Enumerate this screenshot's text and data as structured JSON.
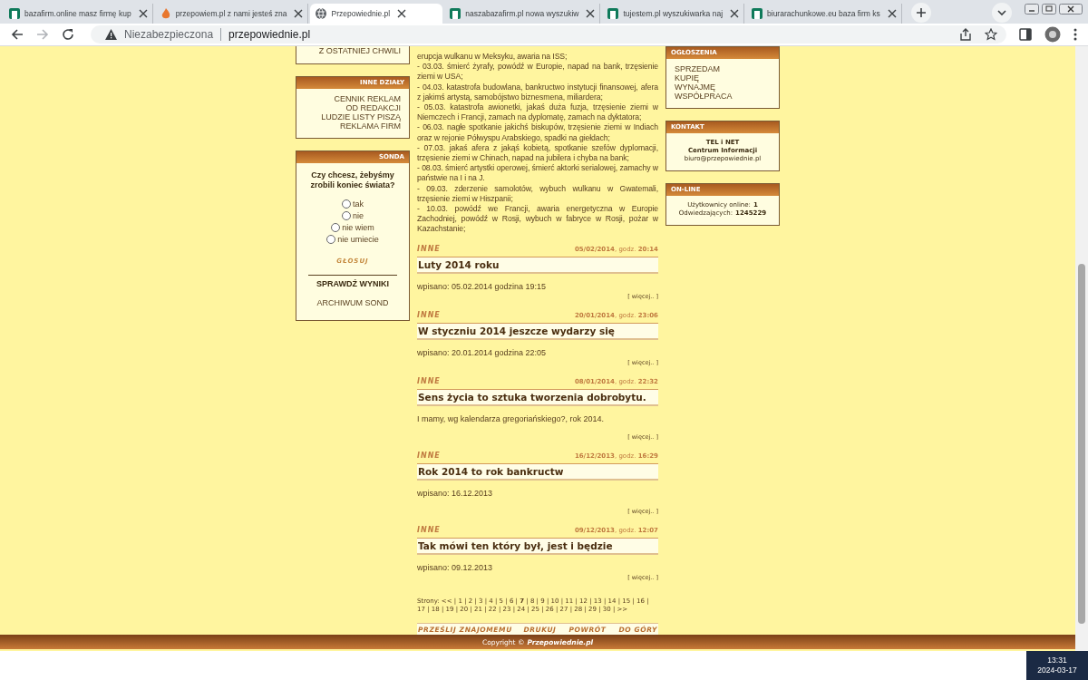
{
  "browser": {
    "tabs": [
      {
        "title": "bazafirm.online masz firmę kup",
        "kind": "sheet",
        "selected": false
      },
      {
        "title": "przepowiem.pl z nami jesteś zna",
        "kind": "flame",
        "selected": false
      },
      {
        "title": "Przepowiednie.pl",
        "kind": "globe",
        "selected": true
      },
      {
        "title": "naszabazafirm.pl nowa wyszukiw",
        "kind": "sheet",
        "selected": false
      },
      {
        "title": "tujestem.pl wyszukiwarka naj",
        "kind": "sheet",
        "selected": false
      },
      {
        "title": "biurarachunkowe.eu baza firm ks",
        "kind": "sheet",
        "selected": false
      }
    ],
    "security": "Niezabezpieczona",
    "url": "przepowiednie.pl"
  },
  "left_sidebar": {
    "cut_box": {
      "links": [
        "Z OSTATNIEJ CHWILI"
      ]
    },
    "sections": {
      "title": "INNE DZIAŁY",
      "links": [
        "CENNIK REKLAM",
        "OD REDAKCJI",
        "LUDZIE LISTY PISZĄ",
        "REKLAMA FIRM"
      ]
    },
    "poll": {
      "title": "SONDA",
      "question": "Czy chcesz, żebyśmy zrobili koniec świata?",
      "options": [
        {
          "label": "tak",
          "selected": false
        },
        {
          "label": "nie",
          "selected": false
        },
        {
          "label": "nie wiem",
          "selected": false
        },
        {
          "label": "nie umiecie",
          "selected": false
        }
      ],
      "vote": "GŁOSUJ",
      "results": "SPRAWDŹ WYNIKI",
      "archive": "ARCHIWUM SOND"
    }
  },
  "content": {
    "intro": [
      "erupcja wulkanu w Meksyku, awaria na ISS;",
      "- 03.03. śmierć żyrafy, powódź w Europie, napad na bank, trzęsienie ziemi w USA;",
      "- 04.03. katastrofa budowlana, bankructwo instytucji finansowej, afera z jakimś artystą, samobójstwo biznesmena, miliardera;",
      "- 05.03. katastrofa awionetki, jakaś duża fuzja, trzęsienie ziemi w Niemczech i Francji, zamach na dyplomatę, zamach na dyktatora;",
      "- 06.03. nagłe spotkanie jakichś biskupów, trzęsienie ziemi w Indiach oraz w rejonie Półwyspu Arabskiego, spadki na giełdach;",
      "- 07.03. jakaś afera z jakąś kobietą, spotkanie szefów dyplomacji, trzęsienie ziemi w Chinach, napad na jubilera i chyba na bank;",
      "- 08.03. śmierć artystki operowej, śmierć aktorki serialowej, zamachy w państwie na I i na J.",
      "- 09.03. zderzenie samolotów, wybuch wulkanu w Gwatemali, trzęsienie ziemi w Hiszpanii;",
      "- 10.03. powódź we Francji, awaria energetyczna w Europie Zachodniej, powódź w Rosji, wybuch w fabryce w Rosji, pożar w Kazachstanie;"
    ],
    "posts": [
      {
        "category": "INNE",
        "date": "**05/02/2014**, godz. **20:14**",
        "title": "Luty 2014 roku",
        "excerpt": "wpisano: 05.02.2014 godzina 19:15",
        "more": "[ więcej.. ]"
      },
      {
        "category": "INNE",
        "date": "**20/01/2014**, godz. **23:06**",
        "title": "W styczniu 2014 jeszcze wydarzy się",
        "excerpt": "wpisano: 20.01.2014 godzina 22:05",
        "more": "[ więcej.. ]"
      },
      {
        "category": "INNE",
        "date": "**08/01/2014**, godz. **22:32**",
        "title": "Sens życia to sztuka tworzenia dobrobytu.",
        "excerpt": "I mamy, wg kalendarza gregoriańskiego?, rok 2014.",
        "more": "[ więcej.. ]"
      },
      {
        "category": "INNE",
        "date": "**16/12/2013**, godz. **16:29**",
        "title": "Rok 2014 to rok bankructw",
        "excerpt": "wpisano: 16.12.2013",
        "more": "[ więcej.. ]"
      },
      {
        "category": "INNE",
        "date": "**09/12/2013**, godz. **12:07**",
        "title": "Tak mówi ten który był, jest i będzie",
        "excerpt": "wpisano: 09.12.2013",
        "more": "[ więcej.. ]"
      }
    ],
    "pagination": {
      "label": "Strony:",
      "prev": "<<",
      "next": ">>",
      "separator": "|",
      "pages": [
        {
          "label": "1",
          "selected": false
        },
        {
          "label": "2",
          "selected": false
        },
        {
          "label": "3",
          "selected": false
        },
        {
          "label": "4",
          "selected": false
        },
        {
          "label": "5",
          "selected": false
        },
        {
          "label": "6",
          "selected": false
        },
        {
          "label": "7",
          "selected": true
        },
        {
          "label": "8",
          "selected": false
        },
        {
          "label": "9",
          "selected": false
        },
        {
          "label": "10",
          "selected": false
        },
        {
          "label": "11",
          "selected": false
        },
        {
          "label": "12",
          "selected": false
        },
        {
          "label": "13",
          "selected": false
        },
        {
          "label": "14",
          "selected": false
        },
        {
          "label": "15",
          "selected": false
        },
        {
          "label": "16",
          "selected": false
        },
        {
          "label": "17",
          "selected": false
        },
        {
          "label": "18",
          "selected": false
        },
        {
          "label": "19",
          "selected": false
        },
        {
          "label": "20",
          "selected": false
        },
        {
          "label": "21",
          "selected": false
        },
        {
          "label": "22",
          "selected": false
        },
        {
          "label": "23",
          "selected": false
        },
        {
          "label": "24",
          "selected": false
        },
        {
          "label": "25",
          "selected": false
        },
        {
          "label": "26",
          "selected": false
        },
        {
          "label": "27",
          "selected": false
        },
        {
          "label": "28",
          "selected": false
        },
        {
          "label": "29",
          "selected": false
        },
        {
          "label": "30",
          "selected": false
        }
      ]
    },
    "actions": {
      "left": "PRZEŚLIJ ZNAJOMEMU",
      "right": [
        "DRUKUJ",
        "POWRÓT",
        "DO GÓRY"
      ]
    }
  },
  "right_sidebar": {
    "ads": {
      "title": "OGŁOSZENIA",
      "links": [
        "SPRZEDAM",
        "KUPIĘ",
        "WYNAJMĘ",
        "WSPÓŁPRACA"
      ]
    },
    "contact": {
      "title": "KONTAKT",
      "lines": [
        {
          "text": "TEL i NET",
          "bold": true
        },
        {
          "text": "Centrum Informacji",
          "bold": true
        },
        {
          "text": "biuro@przepowiednie.pl",
          "bold": false
        }
      ]
    },
    "online": {
      "title": "ON-LINE",
      "stats": [
        {
          "label": "Użytkownicy online:",
          "value": "1"
        },
        {
          "label": "Odwiedzających:",
          "value": "1245229"
        }
      ]
    }
  },
  "footer": {
    "copyright": "Copyright ©",
    "brand": "Przepowiednie.pl"
  },
  "taskbar": {
    "time": "13:31",
    "date": "2024-03-17"
  }
}
